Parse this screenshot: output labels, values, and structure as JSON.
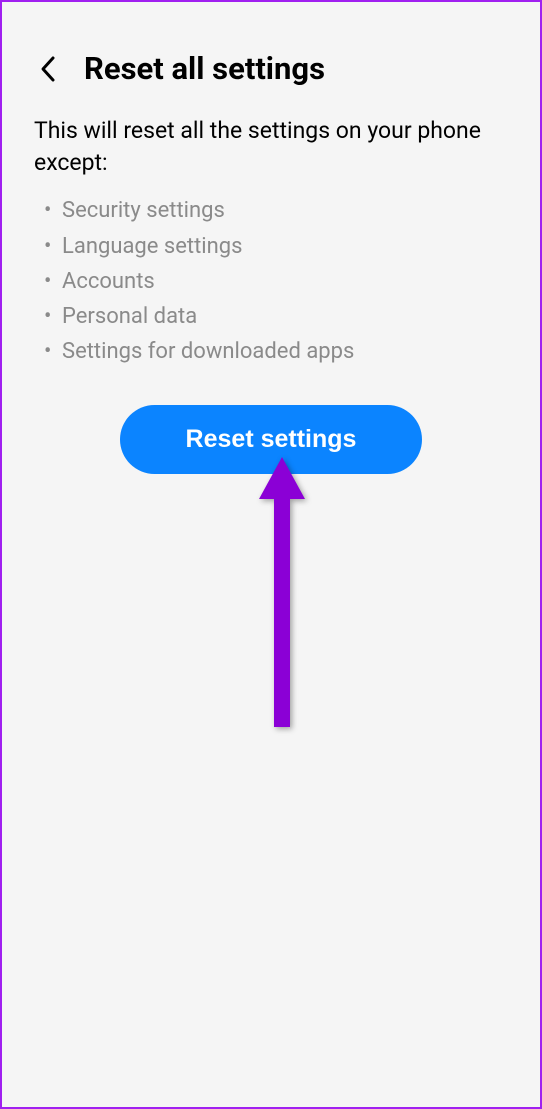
{
  "header": {
    "title": "Reset all settings"
  },
  "description": "This will reset all the settings on your phone except:",
  "exceptions": [
    "Security settings",
    "Language settings",
    "Accounts",
    "Personal data",
    "Settings for downloaded apps"
  ],
  "button": {
    "label": "Reset settings"
  },
  "annotation": {
    "arrow_color": "#8b00d6"
  }
}
